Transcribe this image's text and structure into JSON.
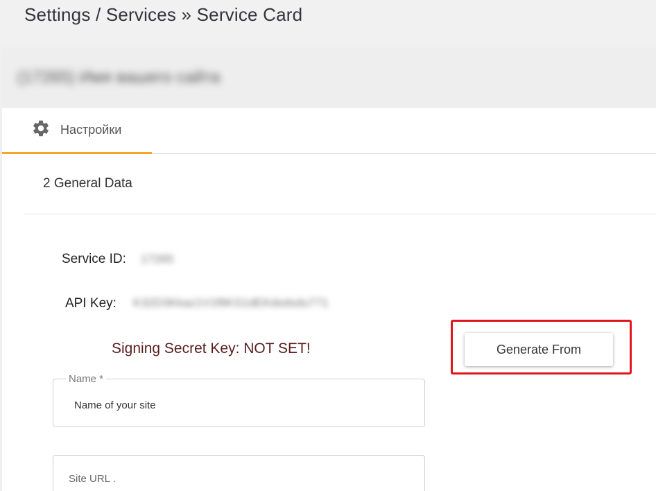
{
  "breadcrumb": "Settings / Services » Service Card",
  "site_header": {
    "title": "(17265) Имя вашего сайта"
  },
  "tabs": [
    {
      "label": "Настройки",
      "icon": "gear-icon",
      "active": true
    }
  ],
  "section": {
    "title": "2 General Data"
  },
  "service_id": {
    "label": "Service ID:",
    "value": "17265"
  },
  "api_key": {
    "label": "API Key:",
    "value": "K32D3Kkaz1V1f8KS1dEKdsdsdu771"
  },
  "signing": {
    "status_text": "Signing Secret Key: NOT SET!"
  },
  "generate_button": {
    "label": "Generate From"
  },
  "name_field": {
    "label": "Name *",
    "value": "Name of your site"
  },
  "url_field": {
    "placeholder": "Site URL ."
  },
  "colors": {
    "tab_accent": "#f5a623",
    "highlight": "#e0151b",
    "signing_status": "#5a1e1e"
  }
}
